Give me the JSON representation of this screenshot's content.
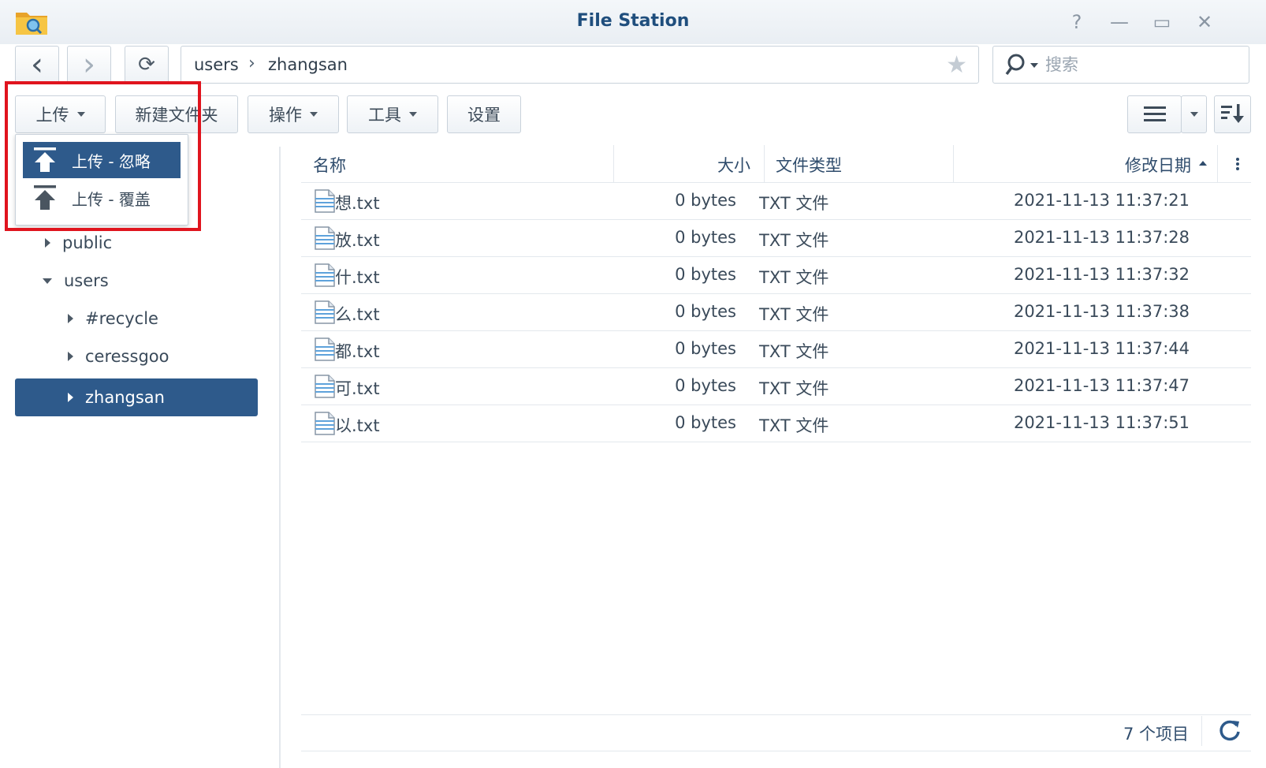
{
  "window": {
    "title": "File Station",
    "controls": {
      "help": "?",
      "minimize": "—",
      "maximize": "▭",
      "close": "✕"
    }
  },
  "nav": {
    "back": "‹",
    "forward": "›",
    "refresh": "⟳",
    "path": [
      "users",
      "zhangsan"
    ],
    "path_separator": "›",
    "favorite": "★",
    "search_placeholder": "搜索"
  },
  "toolbar": {
    "upload": "上传",
    "new_folder": "新建文件夹",
    "action": "操作",
    "tools": "工具",
    "settings": "设置"
  },
  "upload_menu": {
    "items": [
      {
        "label": "上传 - 忽略",
        "selected": true
      },
      {
        "label": "上传 - 覆盖",
        "selected": false
      }
    ]
  },
  "sidebar": {
    "items": [
      {
        "label": "public",
        "expanded": false
      },
      {
        "label": "users",
        "expanded": true
      },
      {
        "label": "#recycle",
        "expanded": false
      },
      {
        "label": "ceressgoo",
        "expanded": false
      },
      {
        "label": "zhangsan",
        "expanded": false,
        "selected": true
      }
    ]
  },
  "file_list": {
    "columns": {
      "name": "名称",
      "size": "大小",
      "type": "文件类型",
      "modified": "修改日期"
    },
    "sort": {
      "column": "modified",
      "direction": "ascending"
    },
    "rows": [
      {
        "name": "想.txt",
        "size": "0 bytes",
        "type": "TXT 文件",
        "modified": "2021-11-13 11:37:21"
      },
      {
        "name": "放.txt",
        "size": "0 bytes",
        "type": "TXT 文件",
        "modified": "2021-11-13 11:37:28"
      },
      {
        "name": "什.txt",
        "size": "0 bytes",
        "type": "TXT 文件",
        "modified": "2021-11-13 11:37:32"
      },
      {
        "name": "么.txt",
        "size": "0 bytes",
        "type": "TXT 文件",
        "modified": "2021-11-13 11:37:38"
      },
      {
        "name": "都.txt",
        "size": "0 bytes",
        "type": "TXT 文件",
        "modified": "2021-11-13 11:37:44"
      },
      {
        "name": "可.txt",
        "size": "0 bytes",
        "type": "TXT 文件",
        "modified": "2021-11-13 11:37:47"
      },
      {
        "name": "以.txt",
        "size": "0 bytes",
        "type": "TXT 文件",
        "modified": "2021-11-13 11:37:51"
      }
    ]
  },
  "footer": {
    "item_count": "7 个项目"
  },
  "colors": {
    "title": "#1f4e7d",
    "selection": "#2e5a8b",
    "highlight_box": "#e0141e",
    "border": "#c9d2db"
  },
  "icons": {
    "app": "folder-search-icon",
    "upload_skip": "upload-icon",
    "upload_overwrite": "upload-icon",
    "file": "text-file-icon",
    "view": "list-view-icon",
    "sort": "sort-icon",
    "column_menu": "more-vertical-icon"
  }
}
